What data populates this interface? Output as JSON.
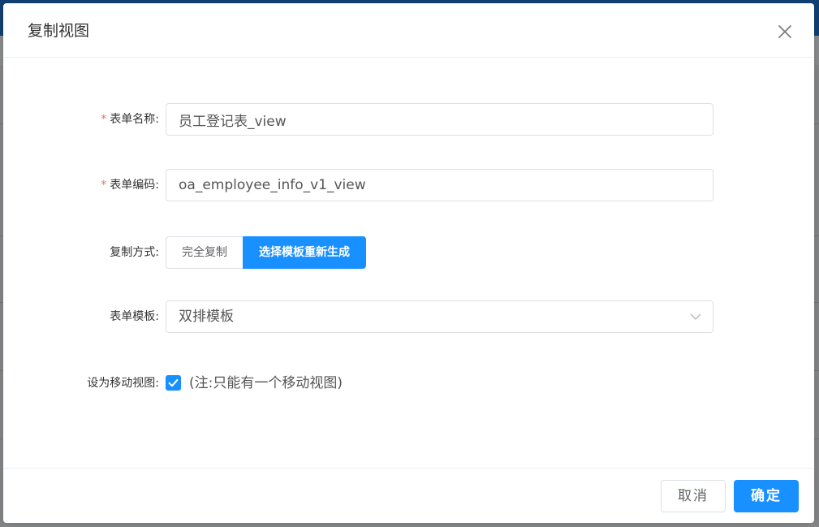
{
  "dialog": {
    "title": "复制视图"
  },
  "form": {
    "table_name": {
      "label": "表单名称:",
      "required": true,
      "value": "员工登记表_view"
    },
    "table_code": {
      "label": "表单编码:",
      "required": true,
      "value": "oa_employee_info_v1_view"
    },
    "copy_mode": {
      "label": "复制方式:",
      "options": [
        "完全复制",
        "选择模板重新生成"
      ],
      "selected": "选择模板重新生成"
    },
    "template": {
      "label": "表单模板:",
      "value": "双排模板"
    },
    "mobile_view": {
      "label": "设为移动视图:",
      "checked": true,
      "note": "(注:只能有一个移动视图)"
    }
  },
  "footer": {
    "cancel_label": "取消",
    "ok_label": "确定"
  },
  "colors": {
    "primary": "#1890ff",
    "required": "#f56c6c",
    "border": "#dcdfe6"
  },
  "icons": {
    "close": "close-icon",
    "dropdown": "chevron-down-icon",
    "checkbox": "check-icon"
  }
}
